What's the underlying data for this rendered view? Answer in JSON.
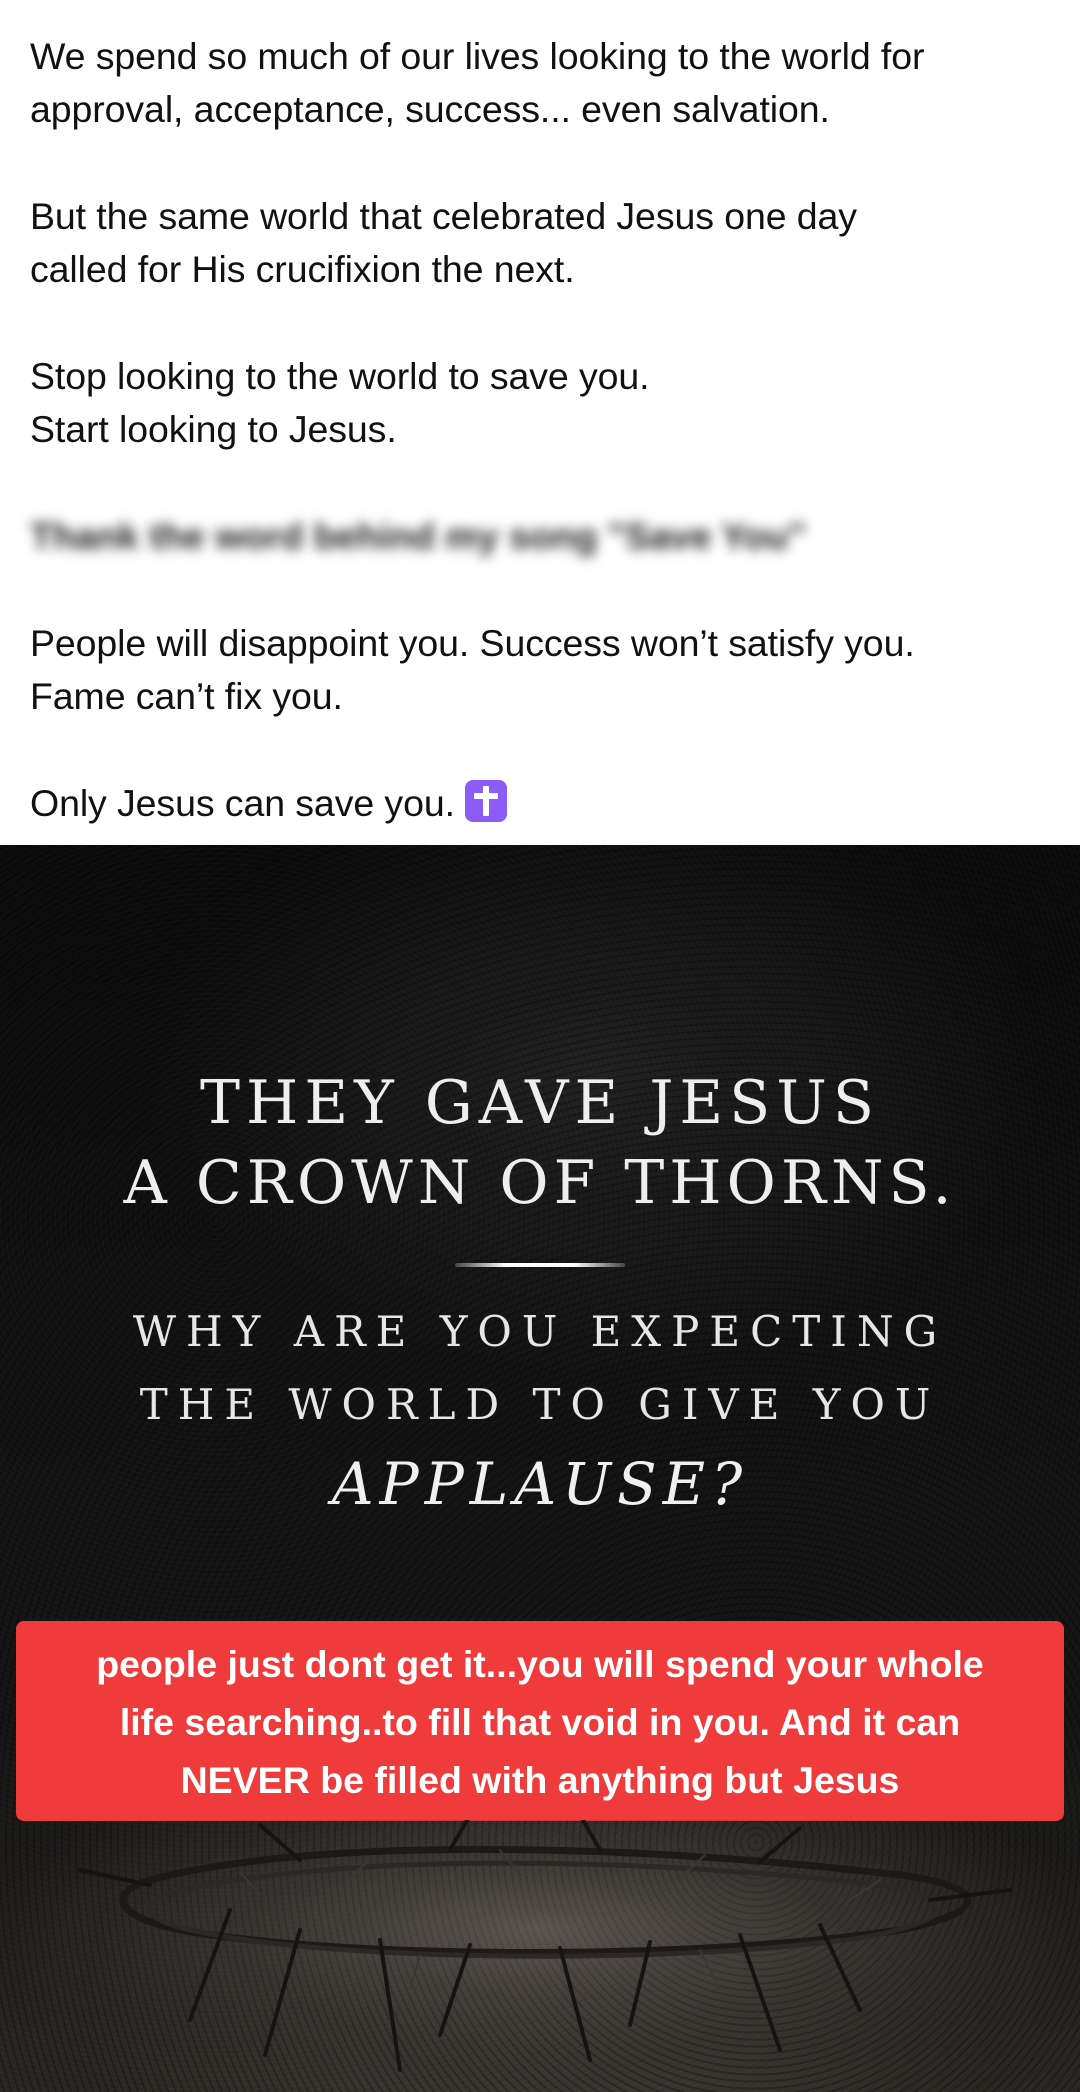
{
  "caption": {
    "lines": [
      "We spend so much of our lives looking to the world for",
      "approval, acceptance, success... even salvation.",
      "But the same world that celebrated Jesus one day",
      "called for His crucifixion the next.",
      "Stop looking to the world to save you.",
      "Start looking to Jesus.",
      "People will disappoint you. Success won’t satisfy you.",
      "Fame can’t fix you.",
      "Only Jesus can save you."
    ],
    "blurred_text": "Thank the word behind my song \"Save You\""
  },
  "poster": {
    "headline_line1": "THEY GAVE JESUS",
    "headline_line2": "A CROWN OF THORNS.",
    "sub_line1": "WHY ARE YOU EXPECTING",
    "sub_line2": "THE WORLD TO GIVE YOU",
    "emphasis": "APPLAUSE?"
  },
  "overlay": {
    "lines": [
      "people just dont get it...you will spend your whole",
      "life searching..to fill that void in you. And it can",
      "NEVER  be filled with anything but Jesus"
    ],
    "background_color": "#ef3b3b"
  },
  "icons": {
    "cross": "latin-cross-emoji"
  }
}
